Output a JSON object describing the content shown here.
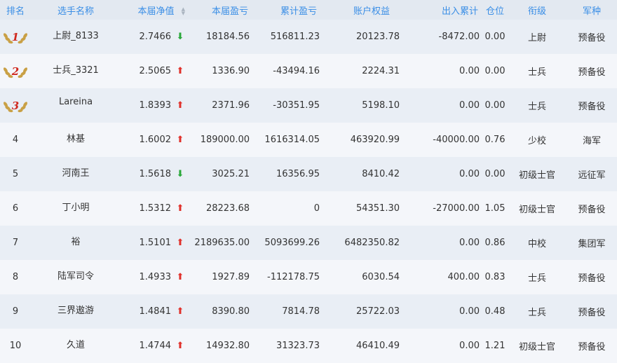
{
  "headers": {
    "rank": "排名",
    "name": "选手名称",
    "nav": "本届净值",
    "session_pnl": "本届盈亏",
    "total_pnl": "累计盈亏",
    "equity": "账户权益",
    "inout": "出入累计",
    "position": "仓位",
    "rank_title": "衔级",
    "branch": "军种"
  },
  "rows": [
    {
      "rank": "1",
      "name": "上尉_8133",
      "nav": "2.7466",
      "trend": "down",
      "session_pnl": "18184.56",
      "total_pnl": "516811.23",
      "equity": "20123.78",
      "inout": "-8472.00",
      "position": "0.00",
      "rank_title": "上尉",
      "branch": "预备役"
    },
    {
      "rank": "2",
      "name": "士兵_3321",
      "nav": "2.5065",
      "trend": "up",
      "session_pnl": "1336.90",
      "total_pnl": "-43494.16",
      "equity": "2224.31",
      "inout": "0.00",
      "position": "0.00",
      "rank_title": "士兵",
      "branch": "预备役"
    },
    {
      "rank": "3",
      "name": "Lareina",
      "nav": "1.8393",
      "trend": "up",
      "session_pnl": "2371.96",
      "total_pnl": "-30351.95",
      "equity": "5198.10",
      "inout": "0.00",
      "position": "0.00",
      "rank_title": "士兵",
      "branch": "预备役"
    },
    {
      "rank": "4",
      "name": "林基",
      "nav": "1.6002",
      "trend": "up",
      "session_pnl": "189000.00",
      "total_pnl": "1616314.05",
      "equity": "463920.99",
      "inout": "-40000.00",
      "position": "0.76",
      "rank_title": "少校",
      "branch": "海军"
    },
    {
      "rank": "5",
      "name": "河南王",
      "nav": "1.5618",
      "trend": "down",
      "session_pnl": "3025.21",
      "total_pnl": "16356.95",
      "equity": "8410.42",
      "inout": "0.00",
      "position": "0.00",
      "rank_title": "初级士官",
      "branch": "远征军"
    },
    {
      "rank": "6",
      "name": "丁小明",
      "nav": "1.5312",
      "trend": "up",
      "session_pnl": "28223.68",
      "total_pnl": "0",
      "equity": "54351.30",
      "inout": "-27000.00",
      "position": "1.05",
      "rank_title": "初级士官",
      "branch": "预备役"
    },
    {
      "rank": "7",
      "name": "裕",
      "nav": "1.5101",
      "trend": "up",
      "session_pnl": "2189635.00",
      "total_pnl": "5093699.26",
      "equity": "6482350.82",
      "inout": "0.00",
      "position": "0.86",
      "rank_title": "中校",
      "branch": "集团军"
    },
    {
      "rank": "8",
      "name": "陆军司令",
      "nav": "1.4933",
      "trend": "up",
      "session_pnl": "1927.89",
      "total_pnl": "-112178.75",
      "equity": "6030.54",
      "inout": "400.00",
      "position": "0.83",
      "rank_title": "士兵",
      "branch": "预备役"
    },
    {
      "rank": "9",
      "name": "三界遨游",
      "nav": "1.4841",
      "trend": "up",
      "session_pnl": "8390.80",
      "total_pnl": "7814.78",
      "equity": "25722.03",
      "inout": "0.00",
      "position": "0.48",
      "rank_title": "士兵",
      "branch": "预备役"
    },
    {
      "rank": "10",
      "name": "久道",
      "nav": "1.4744",
      "trend": "up",
      "session_pnl": "14932.80",
      "total_pnl": "31323.73",
      "equity": "46410.49",
      "inout": "0.00",
      "position": "1.21",
      "rank_title": "初级士官",
      "branch": "预备役"
    }
  ],
  "icons": {
    "up": "arrow-up-icon",
    "down": "arrow-down-icon",
    "medal": "laurel-medal-icon",
    "sort": "sort-icon"
  },
  "colors": {
    "header_text": "#3a8ee6",
    "up": "#e0302a",
    "down": "#2aa83a",
    "medal_gold": "#c9a045",
    "medal_number": "#d0281e"
  }
}
